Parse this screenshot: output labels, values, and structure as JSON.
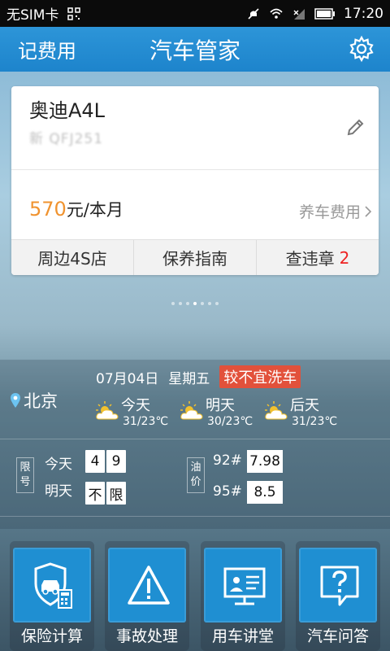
{
  "status_bar": {
    "carrier": "无SIM卡",
    "time": "17:20"
  },
  "header": {
    "left_label": "记费用",
    "title": "汽车管家"
  },
  "car_card": {
    "name": "奥迪A4L",
    "plate": "新 QFJ251",
    "fee_amount": "570",
    "fee_unit": "元/本月",
    "fee_link": "养车费用",
    "actions": [
      {
        "label": "周边4S店"
      },
      {
        "label": "保养指南"
      },
      {
        "label": "查违章",
        "badge": "2"
      }
    ]
  },
  "pager": {
    "count": 7,
    "active": 3
  },
  "weather": {
    "date": "07月04日",
    "weekday": "星期五",
    "wash_advice": "较不宜洗车",
    "city": "北京",
    "days": [
      {
        "label": "今天",
        "temp": "31/23℃",
        "icon": "sun-cloud-icon"
      },
      {
        "label": "明天",
        "temp": "30/23℃",
        "icon": "sun-cloud-icon"
      },
      {
        "label": "后天",
        "temp": "31/23℃",
        "icon": "sun-cloud-icon"
      }
    ]
  },
  "restriction": {
    "tag_line1": "限",
    "tag_line2": "号",
    "today_label": "今天",
    "today_digits": [
      "4",
      "9"
    ],
    "tomorrow_label": "明天",
    "tomorrow_digits": [
      "不",
      "限"
    ]
  },
  "oil": {
    "tag_line1": "油",
    "tag_line2": "价",
    "rows": [
      {
        "grade": "92#",
        "price": "7.98"
      },
      {
        "grade": "95#",
        "price": "8.5"
      }
    ]
  },
  "tiles": [
    {
      "label": "保险计算",
      "icon": "insurance-shield-car-icon"
    },
    {
      "label": "事故处理",
      "icon": "warning-triangle-icon"
    },
    {
      "label": "用车讲堂",
      "icon": "lecture-screen-icon"
    },
    {
      "label": "汽车问答",
      "icon": "question-bubble-icon"
    }
  ],
  "colors": {
    "header_blue": "#2d95d8",
    "accent_orange": "#f0932f",
    "badge_red": "#e2513b",
    "tile_blue": "#1f8fd2"
  }
}
